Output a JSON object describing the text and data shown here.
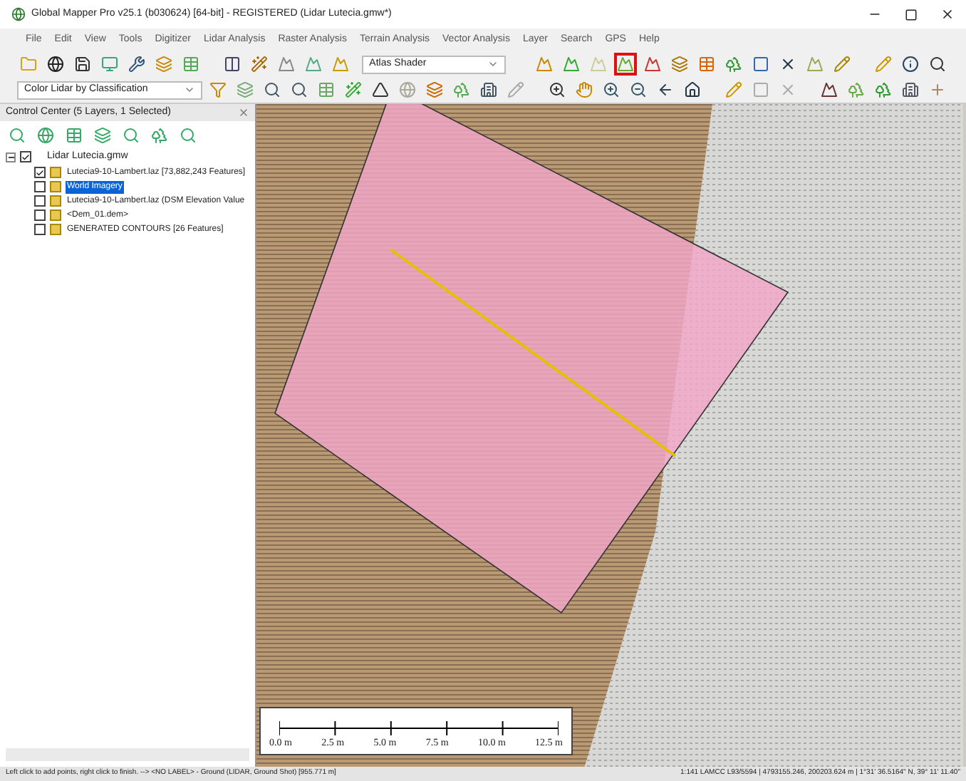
{
  "window": {
    "title": "Global Mapper Pro v25.1 (b030624) [64-bit] - REGISTERED (Lidar Lutecia.gmw*)"
  },
  "menu": [
    "File",
    "Edit",
    "View",
    "Tools",
    "Digitizer",
    "Lidar Analysis",
    "Raster Analysis",
    "Terrain Analysis",
    "Vector Analysis",
    "Layer",
    "Search",
    "GPS",
    "Help"
  ],
  "toolbar": {
    "shader_dropdown": "Atlas Shader",
    "lidar_dropdown": "Color Lidar by Classification",
    "highlighted_tool": true
  },
  "control_center": {
    "title": "Control Center (5 Layers, 1 Selected)",
    "root": {
      "label": "Lidar Lutecia.gmw",
      "checked": true,
      "expanded": true,
      "children": [
        {
          "label": "Lutecia9-10-Lambert.laz [73,882,243 Features]",
          "checked": true,
          "selected": false
        },
        {
          "label": "World Imagery",
          "checked": false,
          "selected": true
        },
        {
          "label": "Lutecia9-10-Lambert.laz (DSM Elevation Value",
          "checked": false,
          "selected": false
        },
        {
          "label": "<Dem_01.dem>",
          "checked": false,
          "selected": false
        },
        {
          "label": "GENERATED CONTOURS [26 Features]",
          "checked": false,
          "selected": false
        }
      ]
    }
  },
  "scale_bar": [
    "0.0 m",
    "2.5 m",
    "5.0 m",
    "7.5 m",
    "10.0 m",
    "12.5 m"
  ],
  "status_bar": {
    "message": "Left click to add points, right click to finish. --> <NO LABEL> - Ground (LIDAR, Ground Shot) [955.771 m]",
    "coordinates": "1:141  LAMCC L93/5594 | 4793155.246, 200203.624 m | 1°31' 36.5164\" N, 39° 11' 11.40\""
  }
}
